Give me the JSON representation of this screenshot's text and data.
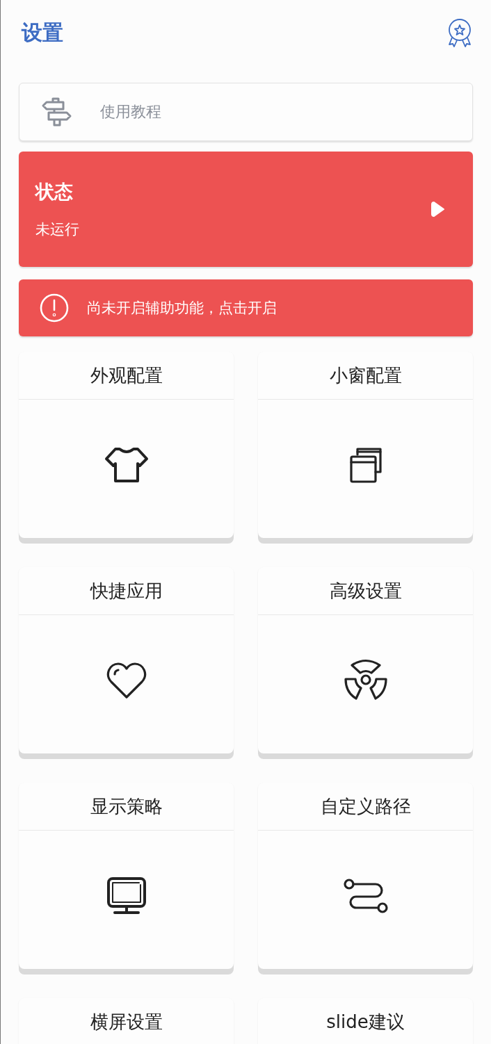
{
  "header": {
    "title": "设置"
  },
  "tutorial": {
    "label": "使用教程"
  },
  "status": {
    "title": "状态",
    "state": "未运行"
  },
  "warning": {
    "text": "尚未开启辅助功能，点击开启"
  },
  "cards": [
    {
      "title": "外观配置",
      "kind": "shirt"
    },
    {
      "title": "小窗配置",
      "kind": "windows"
    },
    {
      "title": "快捷应用",
      "kind": "heart"
    },
    {
      "title": "高级设置",
      "kind": "radiation"
    },
    {
      "title": "显示策略",
      "kind": "monitor"
    },
    {
      "title": "自定义路径",
      "kind": "route"
    },
    {
      "title": "横屏设置"
    },
    {
      "title": "slide建议"
    }
  ]
}
